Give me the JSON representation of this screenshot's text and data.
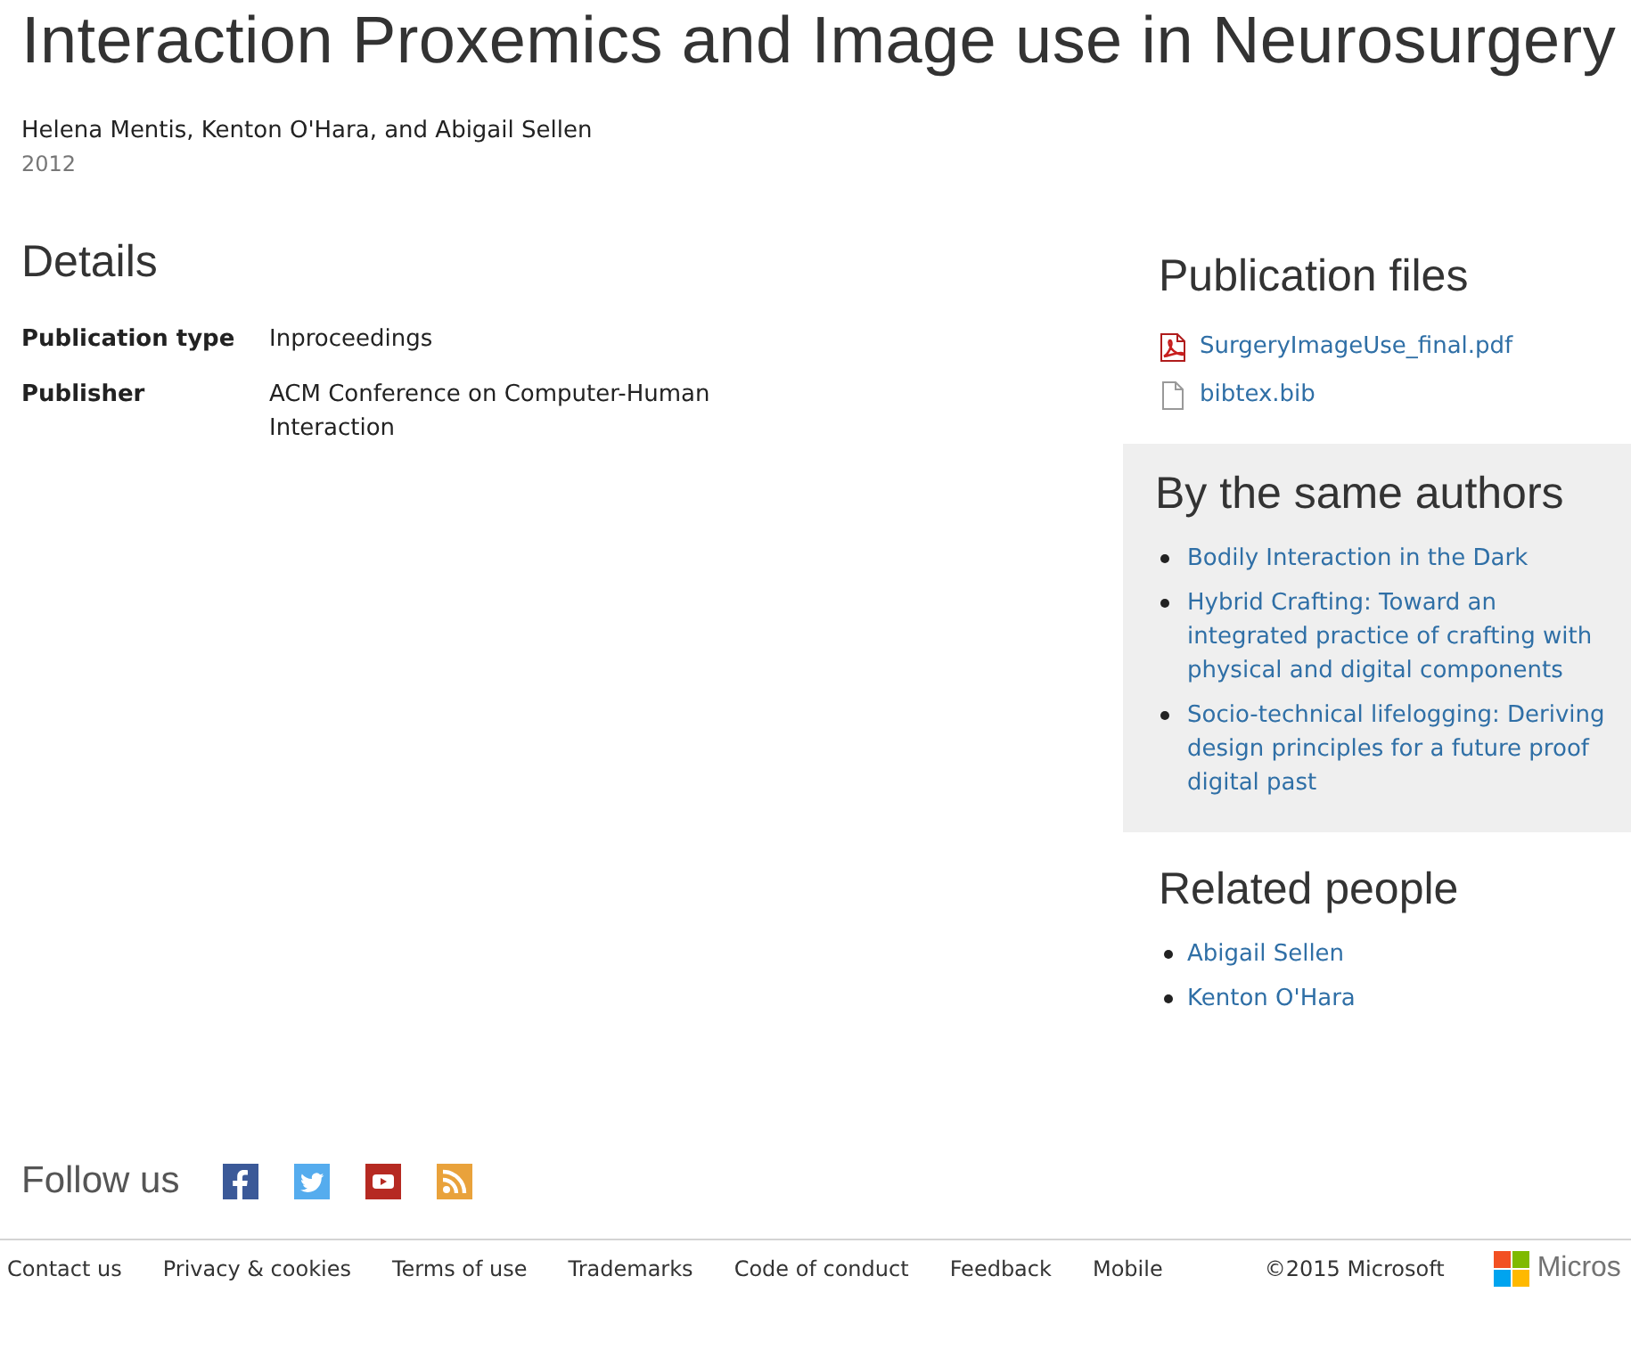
{
  "title": "Interaction Proxemics and Image use in Neurosurgery",
  "authors": "Helena Mentis, Kenton O'Hara, and Abigail Sellen",
  "year": "2012",
  "details": {
    "heading": "Details",
    "fields": [
      {
        "label": "Publication type",
        "value": "Inproceedings"
      },
      {
        "label": "Publisher",
        "value": "ACM Conference on Computer-Human Interaction"
      }
    ]
  },
  "publication_files": {
    "heading": "Publication files",
    "files": [
      {
        "kind": "pdf",
        "name": "SurgeryImageUse_final.pdf"
      },
      {
        "kind": "document",
        "name": "bibtex.bib"
      }
    ]
  },
  "same_authors": {
    "heading": "By the same authors",
    "items": [
      "Bodily Interaction in the Dark",
      "Hybrid Crafting: Toward an integrated practice of crafting with physical and digital components",
      "Socio-technical lifelogging: Deriving design principles for a future proof digital past"
    ]
  },
  "related_people": {
    "heading": "Related people",
    "items": [
      "Abigail Sellen",
      "Kenton O'Hara"
    ]
  },
  "follow": {
    "label": "Follow us",
    "networks": [
      {
        "kind": "facebook"
      },
      {
        "kind": "twitter"
      },
      {
        "kind": "youtube"
      },
      {
        "kind": "rss"
      }
    ]
  },
  "footer": {
    "links": [
      "Contact us",
      "Privacy & cookies",
      "Terms of use",
      "Trademarks",
      "Code of conduct",
      "Feedback",
      "Mobile"
    ],
    "copyright": "©2015 Microsoft",
    "brand": "Micros"
  }
}
